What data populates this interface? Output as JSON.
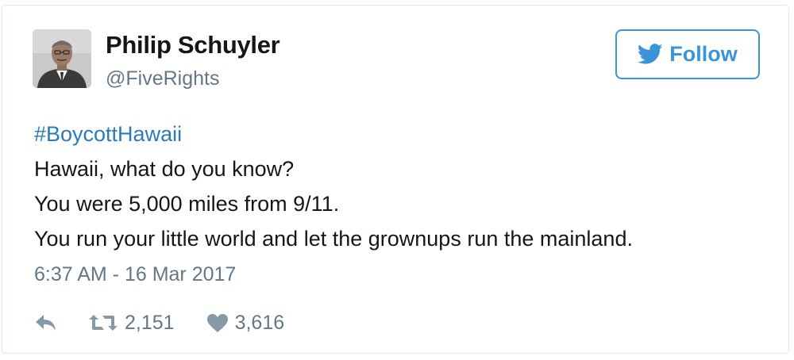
{
  "user": {
    "name": "Philip Schuyler",
    "handle": "@FiveRights"
  },
  "follow_button": {
    "label": "Follow",
    "icon": "twitter-bird-icon"
  },
  "tweet": {
    "hashtag": "#BoycottHawaii",
    "lines": [
      "Hawaii, what do you know?",
      "You were 5,000 miles from 9/11.",
      "You run your little world and let the grownups run the mainland."
    ],
    "timestamp": "6:37 AM - 16 Mar 2017"
  },
  "actions": {
    "reply_icon": "reply-icon",
    "retweet_icon": "retweet-icon",
    "retweet_count": "2,151",
    "like_icon": "heart-icon",
    "like_count": "3,616"
  },
  "colors": {
    "link_blue": "#2b7bb9",
    "follow_blue": "#3b94d9",
    "text": "#14171a",
    "muted": "#657786",
    "border": "#e1e8ed"
  }
}
